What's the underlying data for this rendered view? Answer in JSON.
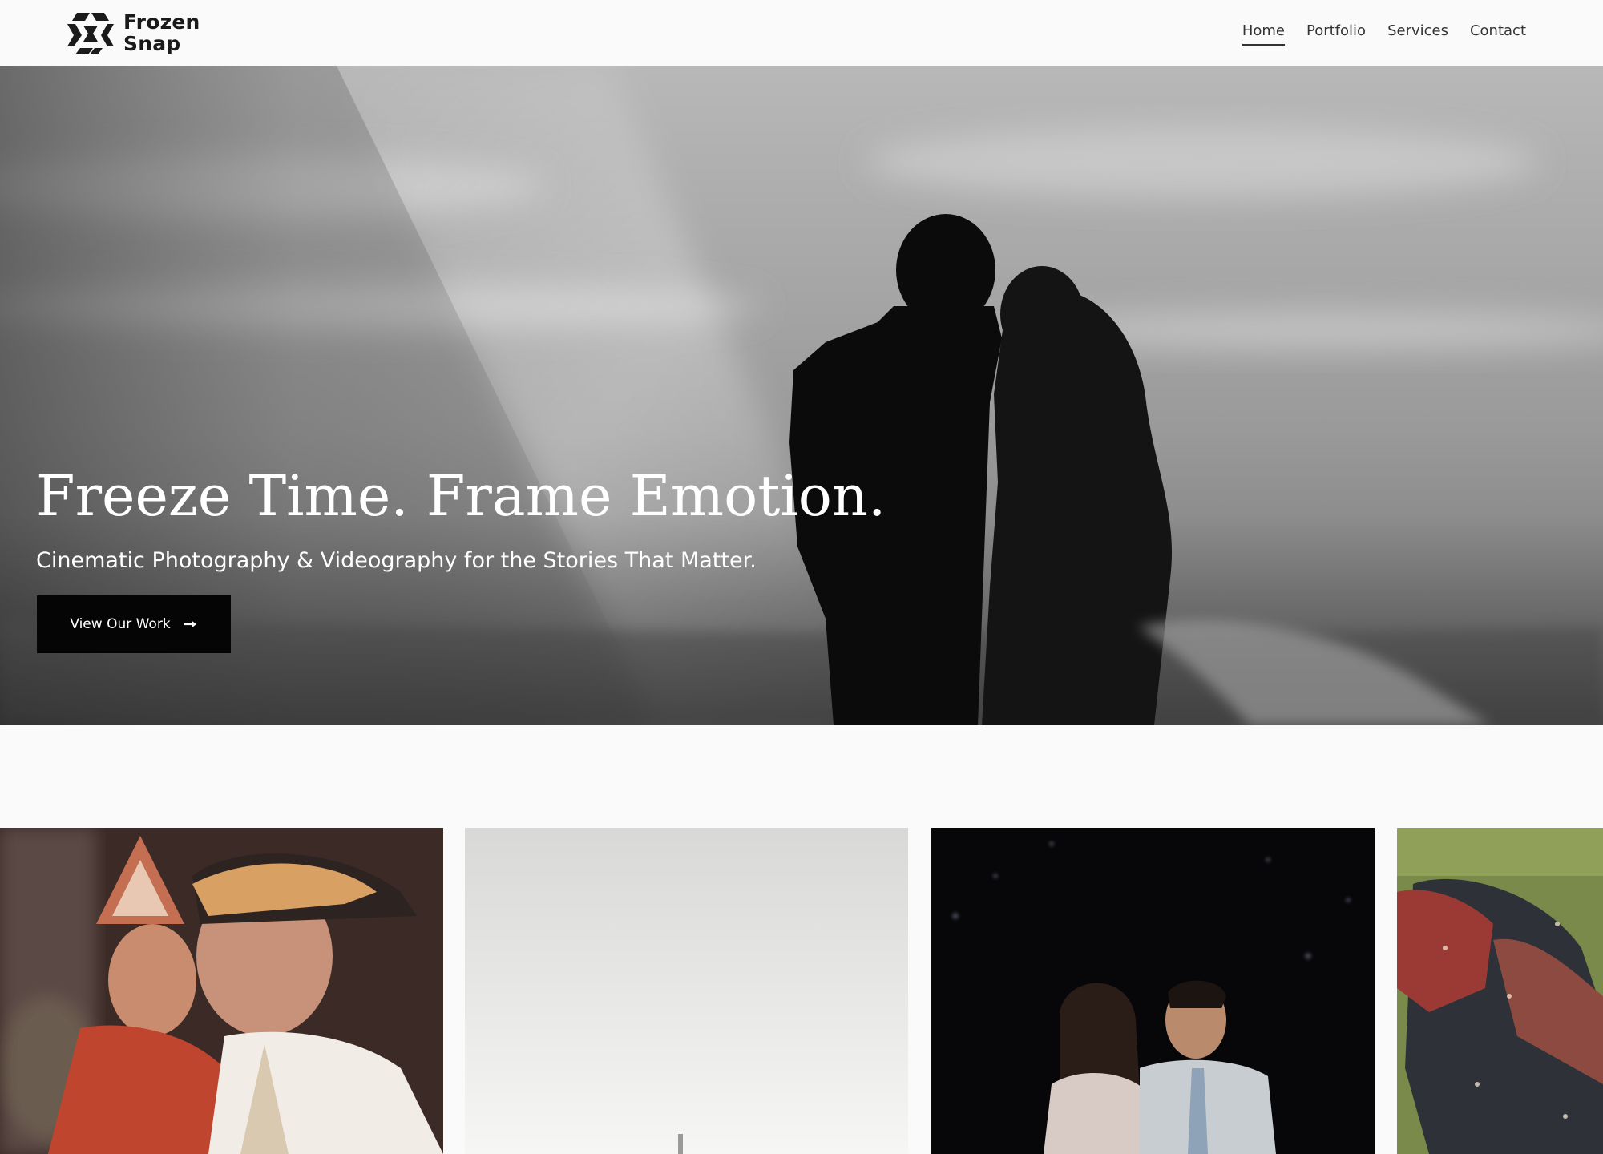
{
  "brand": {
    "name_line1": "Frozen",
    "name_line2": "Snap"
  },
  "nav": {
    "items": [
      {
        "label": "Home",
        "active": true
      },
      {
        "label": "Portfolio",
        "active": false
      },
      {
        "label": "Services",
        "active": false
      },
      {
        "label": "Contact",
        "active": false
      }
    ]
  },
  "hero": {
    "title": "Freeze Time. Frame Emotion.",
    "subtitle": "Cinematic Photography & Videography for the Stories That Matter.",
    "cta_label": "View Our Work",
    "cta_icon": "arrow-right-icon"
  },
  "gallery": {
    "photos": [
      {
        "subject": "couple-in-traditional-wedding-attire"
      },
      {
        "subject": "misty-landscape"
      },
      {
        "subject": "couple-at-night-event"
      },
      {
        "subject": "man-lying-on-grass"
      }
    ]
  },
  "colors": {
    "page_bg": "#fafafa",
    "text": "#111111",
    "cta_bg": "#050505",
    "cta_text": "#ffffff"
  }
}
